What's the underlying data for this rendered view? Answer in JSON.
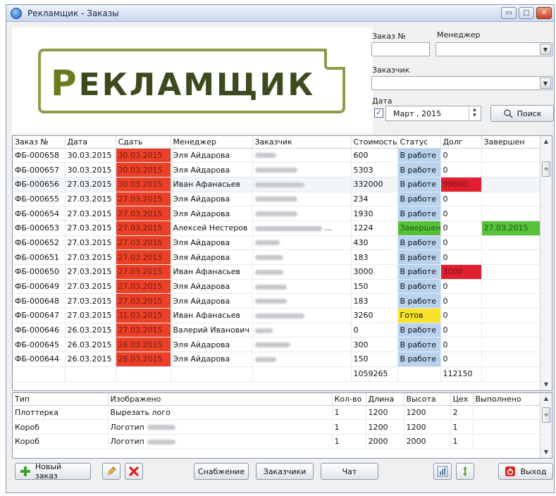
{
  "window": {
    "title": "Рекламщик - Заказы",
    "minimize": "▭",
    "maximize": "□",
    "close": "✕"
  },
  "logo": {
    "first_letter": "Р",
    "rest": "ЕКЛАМЩИК"
  },
  "search": {
    "order_no_label": "Заказ №",
    "order_no_value": "",
    "manager_label": "Менеджер",
    "manager_value": "",
    "customer_label": "Заказчик",
    "customer_value": "",
    "date_label": "Дата",
    "date_checked": "✓",
    "date_value": "Март    , 2015",
    "search_button": "Поиск"
  },
  "orders": {
    "columns": [
      "Заказ №",
      "Дата",
      "Сдать",
      "Менеджер",
      "Заказчик",
      "Стоимость",
      "Статус",
      "Долг",
      "Завершен"
    ],
    "rows": [
      {
        "no": "ФБ-000658",
        "date": "30.03.2015",
        "due": "30.03.2015",
        "manager": "Эля Айдарова",
        "cost": "600",
        "status": "В работе",
        "debt": "0",
        "done": ""
      },
      {
        "no": "ФБ-000657",
        "date": "30.03.2015",
        "due": "30.03.2015",
        "manager": "Эля Айдарова",
        "cost": "5303",
        "status": "В работе",
        "debt": "0",
        "done": ""
      },
      {
        "no": "ФБ-000656",
        "date": "27.03.2015",
        "due": "30.03.2015",
        "manager": "Иван Афанасьев",
        "cost": "332000",
        "status": "В работе",
        "debt": "99600",
        "done": ""
      },
      {
        "no": "ФБ-000655",
        "date": "27.03.2015",
        "due": "27.03.2015",
        "manager": "Эля Айдарова",
        "cost": "234",
        "status": "В работе",
        "debt": "0",
        "done": ""
      },
      {
        "no": "ФБ-000654",
        "date": "27.03.2015",
        "due": "27.03.2015",
        "manager": "Эля Айдарова",
        "cost": "1930",
        "status": "В работе",
        "debt": "0",
        "done": ""
      },
      {
        "no": "ФБ-000653",
        "date": "27.03.2015",
        "due": "27.03.2015",
        "manager": "Алексей Нестеров",
        "customer_suffix": "...",
        "cost": "1224",
        "status": "Завершен",
        "debt": "0",
        "done": "27.03.2015"
      },
      {
        "no": "ФБ-000652",
        "date": "27.03.2015",
        "due": "27.03.2015",
        "manager": "Эля Айдарова",
        "cost": "430",
        "status": "В работе",
        "debt": "0",
        "done": ""
      },
      {
        "no": "ФБ-000651",
        "date": "27.03.2015",
        "due": "27.03.2015",
        "manager": "Эля Айдарова",
        "cost": "183",
        "status": "В работе",
        "debt": "0",
        "done": ""
      },
      {
        "no": "ФБ-000650",
        "date": "27.03.2015",
        "due": "27.03.2015",
        "manager": "Иван Афанасьев",
        "cost": "3000",
        "status": "В работе",
        "debt": "3000",
        "done": ""
      },
      {
        "no": "ФБ-000649",
        "date": "27.03.2015",
        "due": "27.03.2015",
        "manager": "Эля Айдарова",
        "cost": "150",
        "status": "В работе",
        "debt": "0",
        "done": ""
      },
      {
        "no": "ФБ-000648",
        "date": "27.03.2015",
        "due": "27.03.2015",
        "manager": "Эля Айдарова",
        "cost": "183",
        "status": "В работе",
        "debt": "0",
        "done": ""
      },
      {
        "no": "ФБ-000647",
        "date": "27.03.2015",
        "due": "31.03.2015",
        "manager": "Иван Афанасьев",
        "cost": "3260",
        "status": "Готов",
        "debt": "0",
        "done": ""
      },
      {
        "no": "ФБ-000646",
        "date": "26.03.2015",
        "due": "27.03.2015",
        "manager": "Валерий Иванович",
        "cost": "0",
        "status": "В работе",
        "debt": "0",
        "done": ""
      },
      {
        "no": "ФБ-000645",
        "date": "26.03.2015",
        "due": "26.03.2015",
        "manager": "Эля Айдарова",
        "cost": "300",
        "status": "В работе",
        "debt": "0",
        "done": ""
      },
      {
        "no": "ФБ-000644",
        "date": "26.03.2015",
        "due": "26.03.2015",
        "manager": "Эля Айдарова",
        "cost": "150",
        "status": "В работе",
        "debt": "0",
        "done": ""
      }
    ],
    "totals": {
      "cost": "1059265",
      "debt": "112150"
    }
  },
  "items": {
    "columns": [
      "Тип",
      "Изображено",
      "Кол-во",
      "Длина",
      "Высота",
      "Цех",
      "Выполнено"
    ],
    "rows": [
      {
        "type": "Плоттерка",
        "image": "Вырезать лого",
        "qty": "1",
        "length": "1200",
        "height": "1200",
        "shop": "2",
        "done": ""
      },
      {
        "type": "Короб",
        "image": "Логотип",
        "qty": "1",
        "length": "1200",
        "height": "1200",
        "shop": "1",
        "done": ""
      },
      {
        "type": "Короб",
        "image": "Логотип",
        "qty": "1",
        "length": "2000",
        "height": "2000",
        "shop": "1",
        "done": ""
      }
    ]
  },
  "toolbar": {
    "new_order": "Новый заказ",
    "supply": "Снабжение",
    "customers": "Заказчики",
    "chat": "Чат",
    "exit": "Выход"
  },
  "colors": {
    "due_red": "#e94027",
    "debt_red": "#e0202f",
    "done_green": "#56c23a",
    "status_blue": "#b9d3ef",
    "status_yellow": "#f8e32a",
    "logo_olive": "#8f9a4a"
  }
}
